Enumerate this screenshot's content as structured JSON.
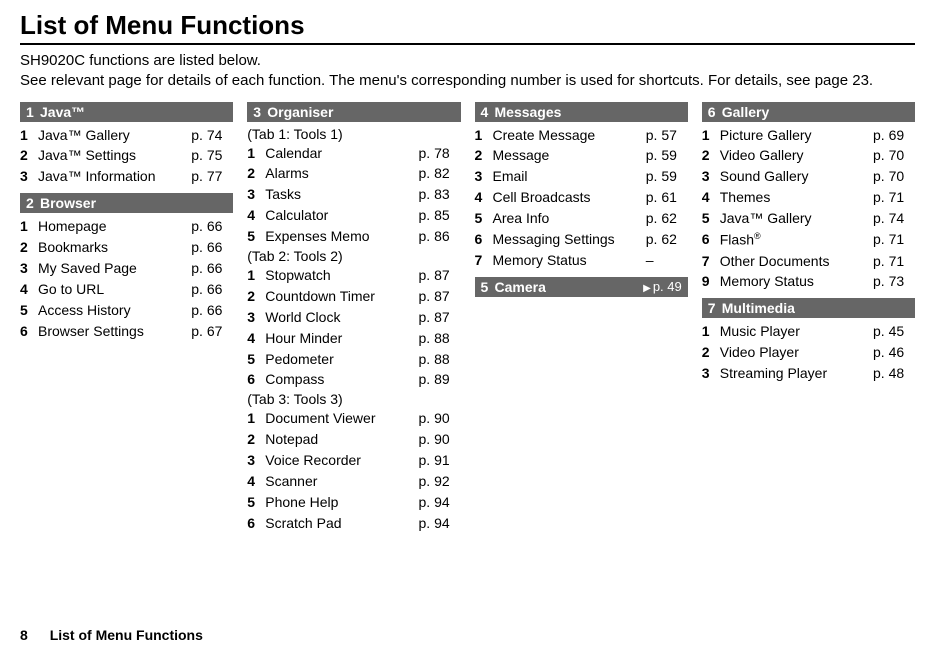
{
  "title": "List of Menu Functions",
  "intro_line1": "SH9020C functions are listed below.",
  "intro_line2": "See relevant page for details of each function. The menu's corresponding number is used for shortcuts. For details, see page 23.",
  "footer_page": "8",
  "footer_title": "List of Menu Functions",
  "sections": {
    "java": {
      "num": "1",
      "title": "Java™",
      "items": [
        {
          "num": "1",
          "label": "Java™ Gallery",
          "page": "p. 74"
        },
        {
          "num": "2",
          "label": "Java™ Settings",
          "page": "p. 75"
        },
        {
          "num": "3",
          "label": "Java™ Information",
          "page": "p. 77"
        }
      ]
    },
    "browser": {
      "num": "2",
      "title": "Browser",
      "items": [
        {
          "num": "1",
          "label": "Homepage",
          "page": "p. 66"
        },
        {
          "num": "2",
          "label": "Bookmarks",
          "page": "p. 66"
        },
        {
          "num": "3",
          "label": "My Saved Page",
          "page": "p. 66"
        },
        {
          "num": "4",
          "label": "Go to URL",
          "page": "p. 66"
        },
        {
          "num": "5",
          "label": "Access History",
          "page": "p. 66"
        },
        {
          "num": "6",
          "label": "Browser Settings",
          "page": "p. 67"
        }
      ]
    },
    "organiser": {
      "num": "3",
      "title": "Organiser",
      "tab1_label": "(Tab 1: Tools 1)",
      "tab1": [
        {
          "num": "1",
          "label": "Calendar",
          "page": "p. 78"
        },
        {
          "num": "2",
          "label": "Alarms",
          "page": "p. 82"
        },
        {
          "num": "3",
          "label": "Tasks",
          "page": "p. 83"
        },
        {
          "num": "4",
          "label": "Calculator",
          "page": "p. 85"
        },
        {
          "num": "5",
          "label": "Expenses Memo",
          "page": "p. 86"
        }
      ],
      "tab2_label": "(Tab 2: Tools 2)",
      "tab2": [
        {
          "num": "1",
          "label": "Stopwatch",
          "page": "p. 87"
        },
        {
          "num": "2",
          "label": "Countdown Timer",
          "page": "p. 87"
        },
        {
          "num": "3",
          "label": "World Clock",
          "page": "p. 87"
        },
        {
          "num": "4",
          "label": "Hour Minder",
          "page": "p. 88"
        },
        {
          "num": "5",
          "label": "Pedometer",
          "page": "p. 88"
        },
        {
          "num": "6",
          "label": "Compass",
          "page": "p. 89"
        }
      ],
      "tab3_label": "(Tab 3: Tools 3)",
      "tab3": [
        {
          "num": "1",
          "label": "Document Viewer",
          "page": "p. 90"
        },
        {
          "num": "2",
          "label": "Notepad",
          "page": "p. 90"
        },
        {
          "num": "3",
          "label": "Voice Recorder",
          "page": "p. 91"
        },
        {
          "num": "4",
          "label": "Scanner",
          "page": "p. 92"
        },
        {
          "num": "5",
          "label": "Phone Help",
          "page": "p. 94"
        },
        {
          "num": "6",
          "label": "Scratch Pad",
          "page": "p. 94"
        }
      ]
    },
    "messages": {
      "num": "4",
      "title": "Messages",
      "items": [
        {
          "num": "1",
          "label": "Create Message",
          "page": "p. 57"
        },
        {
          "num": "2",
          "label": "Message",
          "page": "p. 59"
        },
        {
          "num": "3",
          "label": "Email",
          "page": "p. 59"
        },
        {
          "num": "4",
          "label": "Cell Broadcasts",
          "page": "p. 61"
        },
        {
          "num": "5",
          "label": "Area Info",
          "page": "p. 62"
        },
        {
          "num": "6",
          "label": "Messaging Settings",
          "page": "p. 62"
        },
        {
          "num": "7",
          "label": "Memory Status",
          "page": "–"
        }
      ]
    },
    "camera": {
      "num": "5",
      "title": "Camera",
      "page_ref": "p. 49"
    },
    "gallery": {
      "num": "6",
      "title": "Gallery",
      "items": [
        {
          "num": "1",
          "label": "Picture Gallery",
          "page": "p. 69"
        },
        {
          "num": "2",
          "label": "Video Gallery",
          "page": "p. 70"
        },
        {
          "num": "3",
          "label": "Sound Gallery",
          "page": "p. 70"
        },
        {
          "num": "4",
          "label": "Themes",
          "page": "p. 71"
        },
        {
          "num": "5",
          "label": "Java™ Gallery",
          "page": "p. 74"
        },
        {
          "num": "6",
          "label": "Flash®",
          "page": "p. 71"
        },
        {
          "num": "7",
          "label": "Other Documents",
          "page": "p. 71"
        },
        {
          "num": "9",
          "label": "Memory Status",
          "page": "p. 73"
        }
      ]
    },
    "multimedia": {
      "num": "7",
      "title": "Multimedia",
      "items": [
        {
          "num": "1",
          "label": "Music Player",
          "page": "p. 45"
        },
        {
          "num": "2",
          "label": "Video Player",
          "page": "p. 46"
        },
        {
          "num": "3",
          "label": "Streaming Player",
          "page": "p. 48"
        }
      ]
    }
  }
}
